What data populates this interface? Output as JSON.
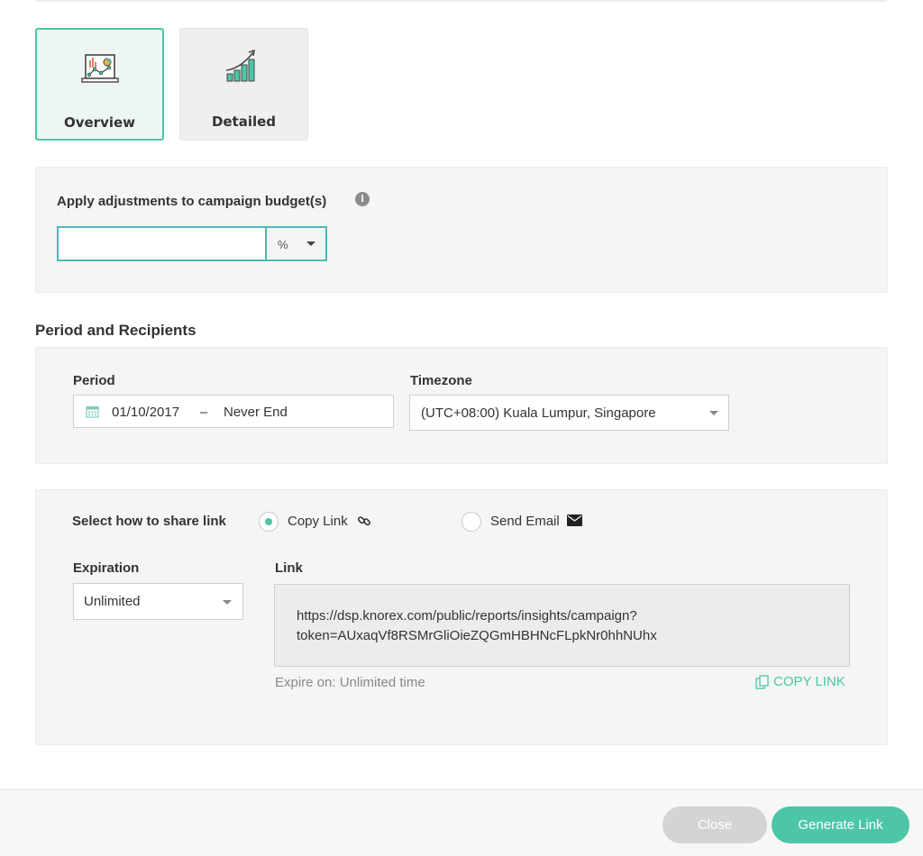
{
  "report_types": [
    {
      "label": "Overview",
      "icon": "analytics-laptop-icon",
      "selected": true
    },
    {
      "label": "Detailed",
      "icon": "growth-bar-chart-icon",
      "selected": false
    }
  ],
  "budget": {
    "label": "Apply adjustments to campaign budget(s)",
    "info_icon": "info-circle-icon",
    "value": "",
    "unit": "%"
  },
  "period_section": {
    "title": "Period and Recipients",
    "period_label": "Period",
    "start_date": "01/10/2017",
    "separator": "–",
    "end_date": "Never End",
    "timezone_label": "Timezone",
    "timezone_value": "(UTC+08:00) Kuala Lumpur, Singapore"
  },
  "share": {
    "prompt": "Select how to share link",
    "options": [
      {
        "label": "Copy Link",
        "icon": "link-icon",
        "selected": true
      },
      {
        "label": "Send Email",
        "icon": "envelope-icon",
        "selected": false
      }
    ],
    "expiration_label": "Expiration",
    "expiration_value": "Unlimited",
    "link_label": "Link",
    "link_line1": "https://dsp.knorex.com/public/reports/insights/campaign?",
    "link_line2": "token=AUxaqVf8RSMrGliOieZQGmHBHNcFLpkNr0hhNUhx",
    "expire_note": "Expire on: Unlimited time",
    "copy_link_action": "COPY LINK"
  },
  "footer": {
    "close_label": "Close",
    "generate_label": "Generate Link"
  },
  "colors": {
    "accent": "#4cc6a7",
    "input_focus": "#4cbab4",
    "panel_bg": "#f5f5f5"
  }
}
